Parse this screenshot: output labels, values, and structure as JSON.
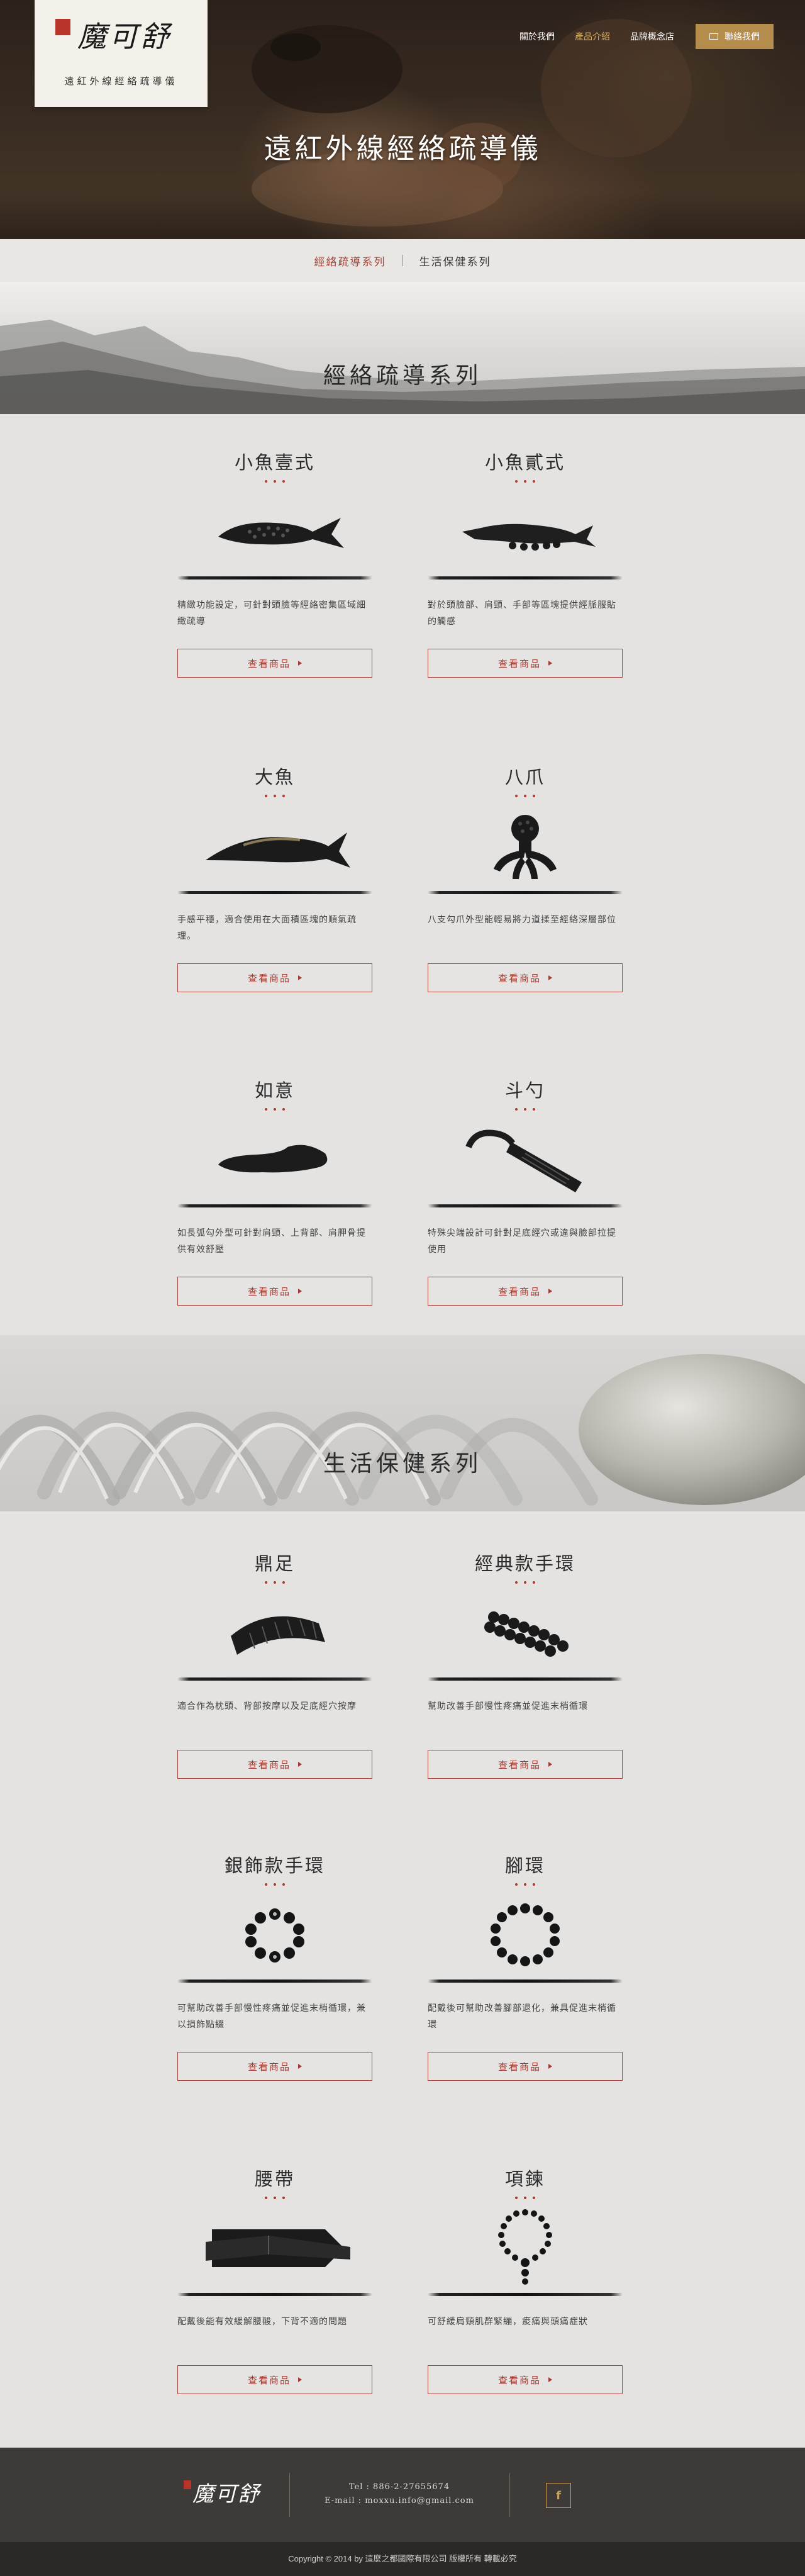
{
  "brand": {
    "logo_text": "魔可舒",
    "subtitle": "遠紅外線經絡疏導儀"
  },
  "nav": {
    "items": [
      {
        "label": "關於我們",
        "active": false
      },
      {
        "label": "產品介紹",
        "active": true
      },
      {
        "label": "品牌概念店",
        "active": false
      }
    ],
    "contact_label": "聯絡我們"
  },
  "hero": {
    "title": "遠紅外線經絡疏導儀"
  },
  "subnav": {
    "items": [
      "經絡疏導系列",
      "生活保健系列"
    ]
  },
  "sections": [
    {
      "title": "經絡疏導系列",
      "products": [
        {
          "name": "小魚壹式",
          "desc": "精緻功能設定，可針對頭臉等經絡密集區域細緻疏導",
          "button": "查看商品",
          "icon": "small-fish-one-icon"
        },
        {
          "name": "小魚貳式",
          "desc": "對於頭臉部、肩頸、手部等區塊提供經脈服貼的觸感",
          "button": "查看商品",
          "icon": "small-fish-two-icon"
        },
        {
          "name": "大魚",
          "desc": "手感平穩，適合使用在大面積區塊的順氣疏理。",
          "button": "查看商品",
          "icon": "big-fish-icon"
        },
        {
          "name": "八爪",
          "desc": "八支勾爪外型能輕易將力道揉至經絡深層部位",
          "button": "查看商品",
          "icon": "octopus-icon"
        },
        {
          "name": "如意",
          "desc": "如長弧勾外型可針對肩頸、上背部、肩胛骨提供有效舒壓",
          "button": "查看商品",
          "icon": "ruyi-icon"
        },
        {
          "name": "斗勺",
          "desc": "特殊尖端設計可針對足底經穴或違與臉部拉提使用",
          "button": "查看商品",
          "icon": "ladle-icon"
        }
      ]
    },
    {
      "title": "生活保健系列",
      "products": [
        {
          "name": "鼎足",
          "desc": "適合作為枕頭、背部按摩以及足底經穴按摩",
          "button": "查看商品",
          "icon": "foot-board-icon"
        },
        {
          "name": "經典款手環",
          "desc": "幫助改善手部慢性疼痛並促進末梢循環",
          "button": "查看商品",
          "icon": "classic-bracelet-icon"
        },
        {
          "name": "銀飾款手環",
          "desc": "可幫助改善手部慢性疼痛並促進末梢循環，兼以損飾點綴",
          "button": "查看商品",
          "icon": "silver-bracelet-icon"
        },
        {
          "name": "腳環",
          "desc": "配戴後可幫助改善腳部退化，兼具促進末梢循環",
          "button": "查看商品",
          "icon": "anklet-icon"
        },
        {
          "name": "腰帶",
          "desc": "配戴後能有效緩解腰酸，下背不適的問題",
          "button": "查看商品",
          "icon": "waist-belt-icon"
        },
        {
          "name": "項鍊",
          "desc": "可舒緩肩頸肌群緊繃，痠痛與頭痛症狀",
          "button": "查看商品",
          "icon": "necklace-icon"
        }
      ]
    }
  ],
  "footer": {
    "logo_text": "魔可舒",
    "tel": "Tel : 886-2-27655674",
    "email": "E-mail : moxxu.info@gmail.com",
    "facebook_label": "f",
    "copyright": "Copyright © 2014 by 這麼之都國際有限公司 版權所有 轉載必究"
  },
  "colors": {
    "accent_red": "#a6443a",
    "gold": "#b48c4b",
    "footer_bg": "#3e3a37"
  }
}
